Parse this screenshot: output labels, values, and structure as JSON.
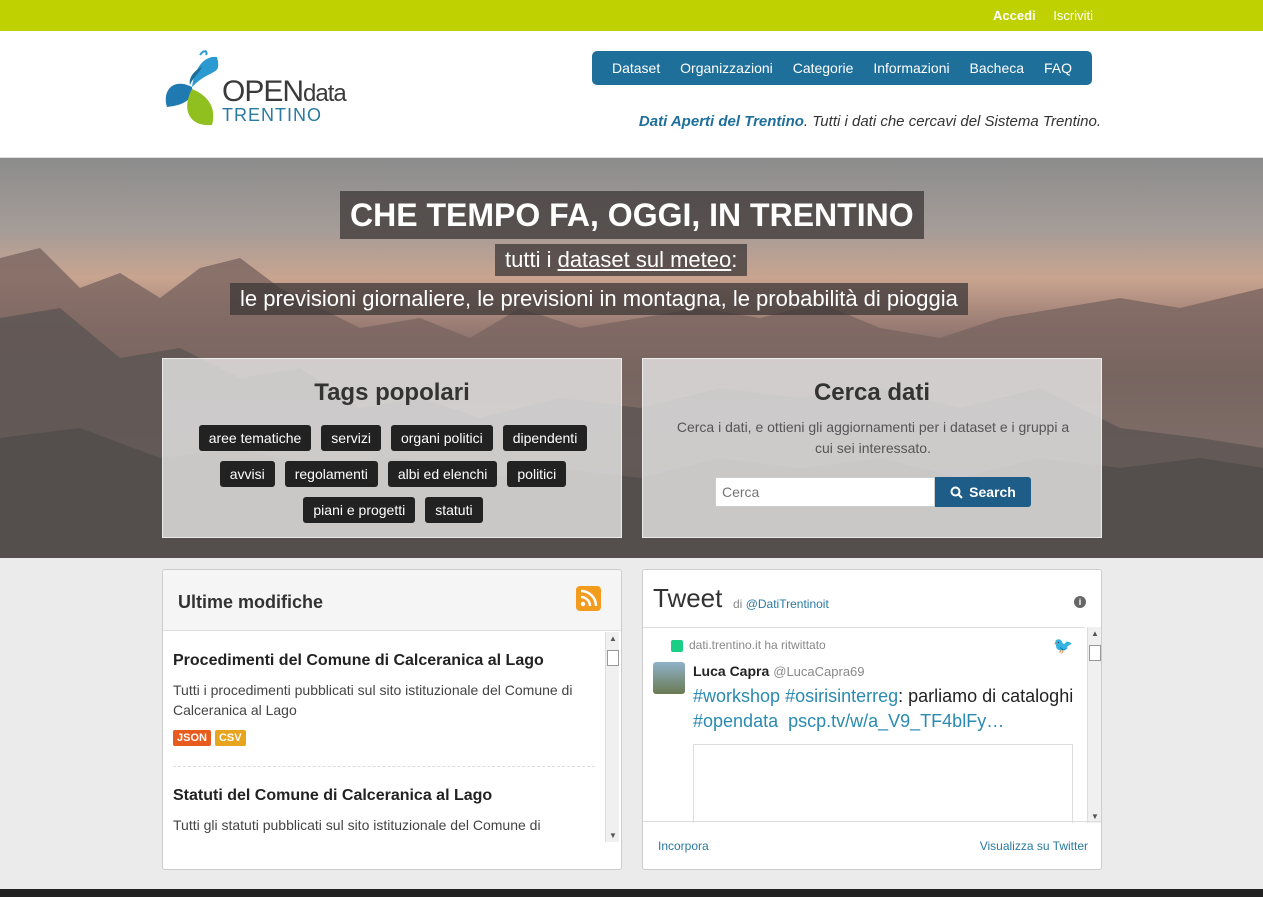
{
  "topbar": {
    "login": "Accedi",
    "signup": "Iscriviti"
  },
  "logo": {
    "open": "OPEN",
    "data": "data",
    "region": "TRENTINO"
  },
  "nav": {
    "items": [
      "Dataset",
      "Organizzazioni",
      "Categorie",
      "Informazioni",
      "Bacheca",
      "FAQ"
    ]
  },
  "tagline": {
    "bold": "Dati Aperti del Trentino",
    "rest": ". Tutti i dati che cercavi del Sistema Trentino."
  },
  "hero": {
    "title": "CHE TEMPO FA, OGGI, IN TRENTINO",
    "sub1_prefix": "tutti i ",
    "sub1_link": "dataset sul meteo",
    "sub1_suffix": ":",
    "sub2": "le previsioni giornaliere, le previsioni in montagna, le probabilità di pioggia"
  },
  "tags_panel": {
    "title": "Tags popolari",
    "tags": [
      "aree tematiche",
      "servizi",
      "organi politici",
      "dipendenti",
      "avvisi",
      "regolamenti",
      "albi ed elenchi",
      "politici",
      "piani e progetti",
      "statuti"
    ]
  },
  "search_panel": {
    "title": "Cerca dati",
    "description": "Cerca i dati, e ottieni gli aggiornamenti per i dataset e i gruppi a cui sei interessato.",
    "placeholder": "Cerca",
    "button": "Search"
  },
  "recent": {
    "title": "Ultime modifiche",
    "items": [
      {
        "title": "Procedimenti del Comune di Calceranica al Lago",
        "desc": "Tutti i procedimenti pubblicati sul sito istituzionale del Comune di Calceranica al Lago",
        "formats": [
          "JSON",
          "CSV"
        ]
      },
      {
        "title": "Statuti del Comune di Calceranica al Lago",
        "desc": "Tutti gli statuti pubblicati sul sito istituzionale del Comune di"
      }
    ]
  },
  "tweets": {
    "title": "Tweet",
    "by_prefix": "di",
    "handle": "@DatiTrentinoit",
    "retweet_note": "dati.trentino.it ha ritwittato",
    "author_name": "Luca Capra",
    "author_handle": "@LucaCapra69",
    "text_h1": "#workshop",
    "text_h2": "#osirisinterreg",
    "text_plain": ": parliamo di cataloghi",
    "text_h3": "#opendata",
    "text_link": "pscp.tv/w/a_V9_TF4blFy…",
    "embed": "Incorpora",
    "view_on": "Visualizza su Twitter"
  },
  "colors": {
    "topbar": "#bfd100",
    "nav": "#1e6f9a",
    "search_button": "#1e5d87",
    "rss": "#f39b1c"
  }
}
